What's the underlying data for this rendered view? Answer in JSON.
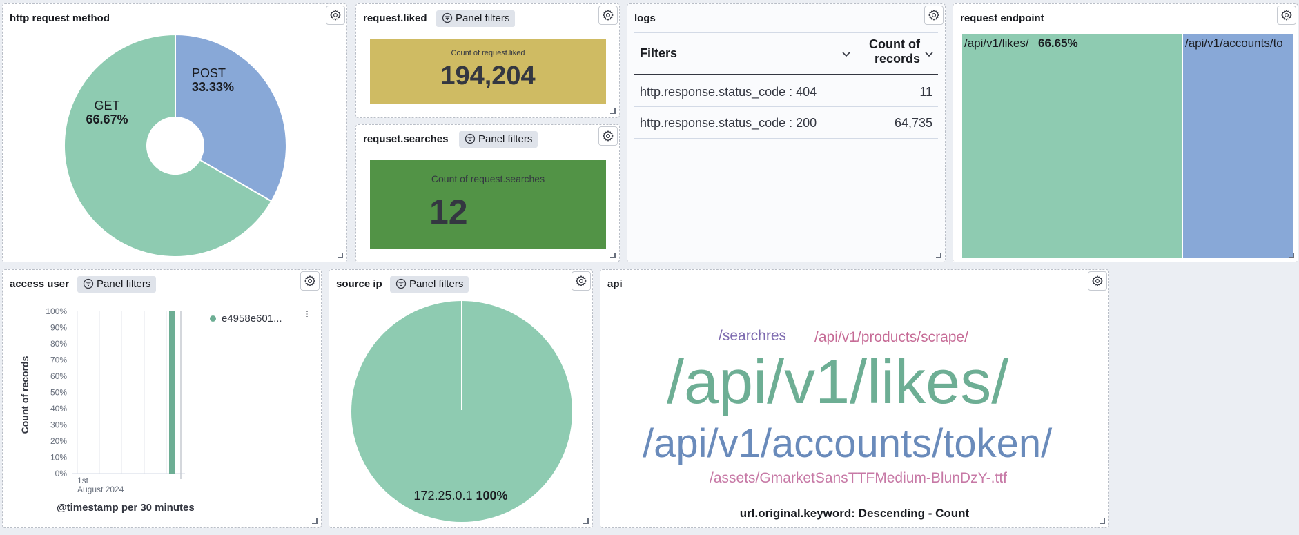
{
  "colors": {
    "green": "#8ecbb1",
    "blue": "#88a8d7",
    "gold": "#cfbb63",
    "darkgreen": "#529346",
    "wc_green": "#6dae94",
    "wc_blue": "#6a8bbb",
    "wc_purple": "#7e6bb0",
    "wc_pink": "#c66b96",
    "wc_pink2": "#c779a6"
  },
  "panels": {
    "http_method": {
      "title": "http request method",
      "chart_data": {
        "type": "pie",
        "slices": [
          {
            "label": "GET",
            "value": 66.67,
            "display": "66.67%"
          },
          {
            "label": "POST",
            "value": 33.33,
            "display": "33.33%"
          }
        ]
      }
    },
    "liked": {
      "title": "request.liked",
      "filter_label": "Panel filters",
      "metric_label": "Count of request.liked",
      "metric_value": "194,204"
    },
    "searches": {
      "title": "requset.searches",
      "filter_label": "Panel filters",
      "metric_label": "Count of request.searches",
      "metric_value": "12"
    },
    "logs": {
      "title": "logs",
      "columns": [
        "Filters",
        "Count of records"
      ],
      "rows": [
        {
          "filter": "http.response.status_code : 404",
          "count": "11"
        },
        {
          "filter": "http.response.status_code : 200",
          "count": "64,735"
        }
      ]
    },
    "endpoint": {
      "title": "request endpoint",
      "chart_data": {
        "type": "treemap",
        "items": [
          {
            "label": "/api/v1/likes/",
            "value": 66.65,
            "display": "66.65%"
          },
          {
            "label": "/api/v1/accounts/token/",
            "value": 33.35,
            "display": ""
          }
        ]
      },
      "label1": "/api/v1/likes/",
      "pct1": "66.65%",
      "label2": "/api/v1/accounts/to"
    },
    "access_user": {
      "title": "access user",
      "filter_label": "Panel filters",
      "chart_data": {
        "type": "bar",
        "ylabel": "Count of records",
        "xlabel": "@timestamp per 30 minutes",
        "yticks": [
          "100%",
          "90%",
          "80%",
          "70%",
          "60%",
          "50%",
          "40%",
          "30%",
          "20%",
          "10%",
          "0%"
        ],
        "xtick_day": "1st",
        "xtick_month": "August 2024",
        "series": [
          {
            "name": "e4958e601...",
            "values": [
              100
            ]
          }
        ]
      }
    },
    "source_ip": {
      "title": "source ip",
      "filter_label": "Panel filters",
      "chart_data": {
        "type": "pie",
        "slices": [
          {
            "label": "172.25.0.1",
            "value": 100,
            "display": "100%"
          }
        ]
      }
    },
    "api": {
      "title": "api",
      "words": [
        "/searchres",
        "/api/v1/products/scrape/",
        "/api/v1/likes/",
        "/api/v1/accounts/token/",
        "/assets/GmarketSansTTFMedium-BlunDzY-.ttf"
      ],
      "footer": "url.original.keyword: Descending - Count"
    }
  }
}
